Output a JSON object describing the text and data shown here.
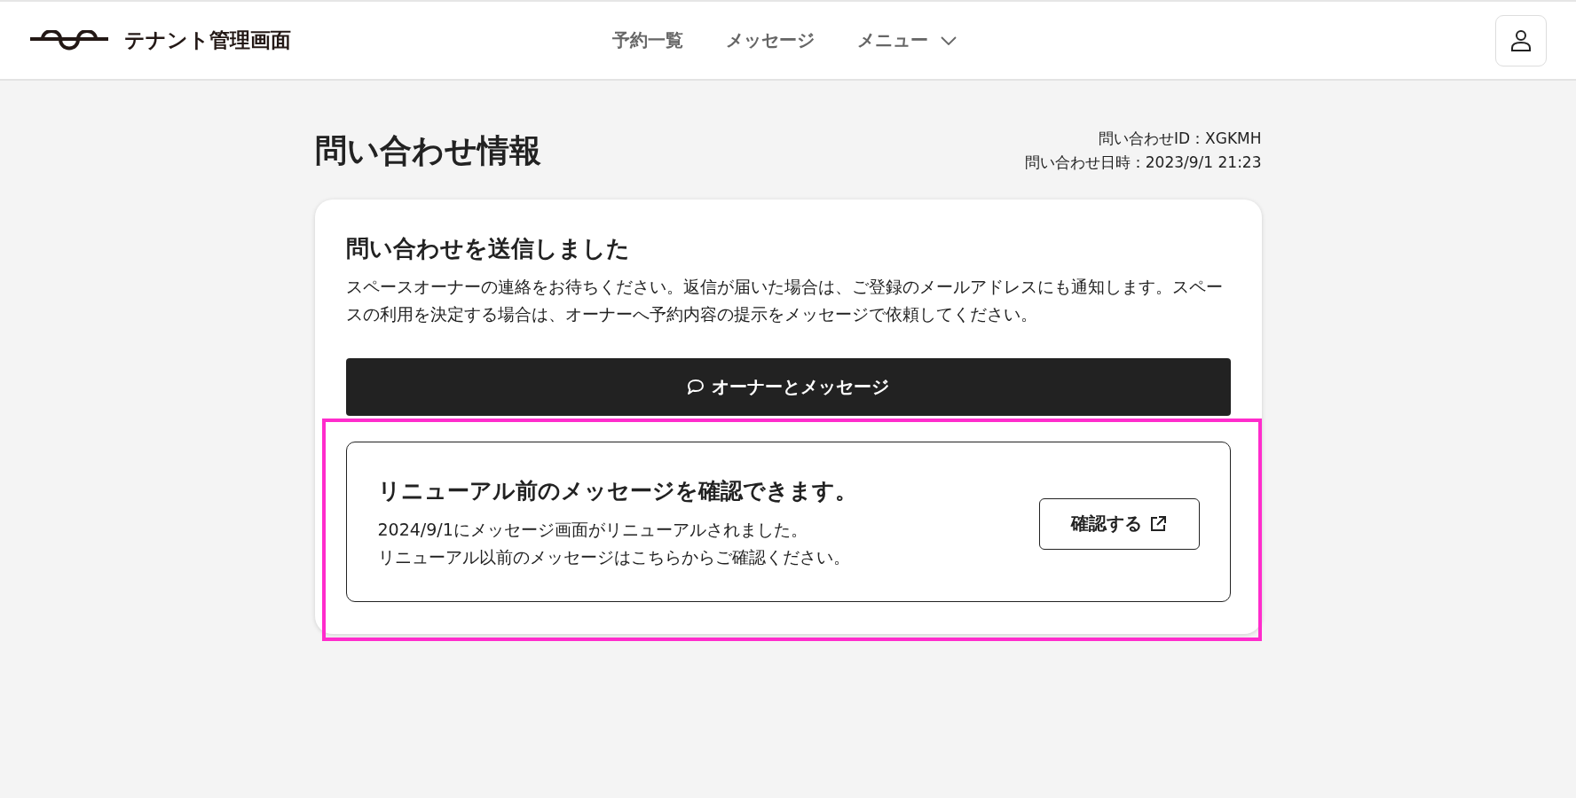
{
  "header": {
    "title": "テナント管理画面",
    "nav": [
      {
        "label": "予約一覧",
        "kind": "link"
      },
      {
        "label": "メッセージ",
        "kind": "link"
      },
      {
        "label": "メニュー",
        "kind": "dropdown"
      }
    ]
  },
  "page": {
    "title": "問い合わせ情報",
    "meta": [
      "問い合わせID：XGKMH",
      "問い合わせ日時：2023/9/1 21:23"
    ]
  },
  "card": {
    "heading": "問い合わせを送信しました",
    "body": "スペースオーナーの連絡をお待ちください。返信が届いた場合は、ご登録のメールアドレスにも通知します。スペースの利用を決定する場合は、オーナーへ予約内容の提示をメッセージで依頼してください。",
    "primary_button": "オーナーとメッセージ",
    "notice": {
      "heading": "リニューアル前のメッセージを確認できます。",
      "lines": [
        "2024/9/1にメッセージ画面がリニューアルされました。",
        "リニューアル以前のメッセージはこちらからご確認ください。"
      ],
      "button": "確認する",
      "highlighted": true
    }
  }
}
